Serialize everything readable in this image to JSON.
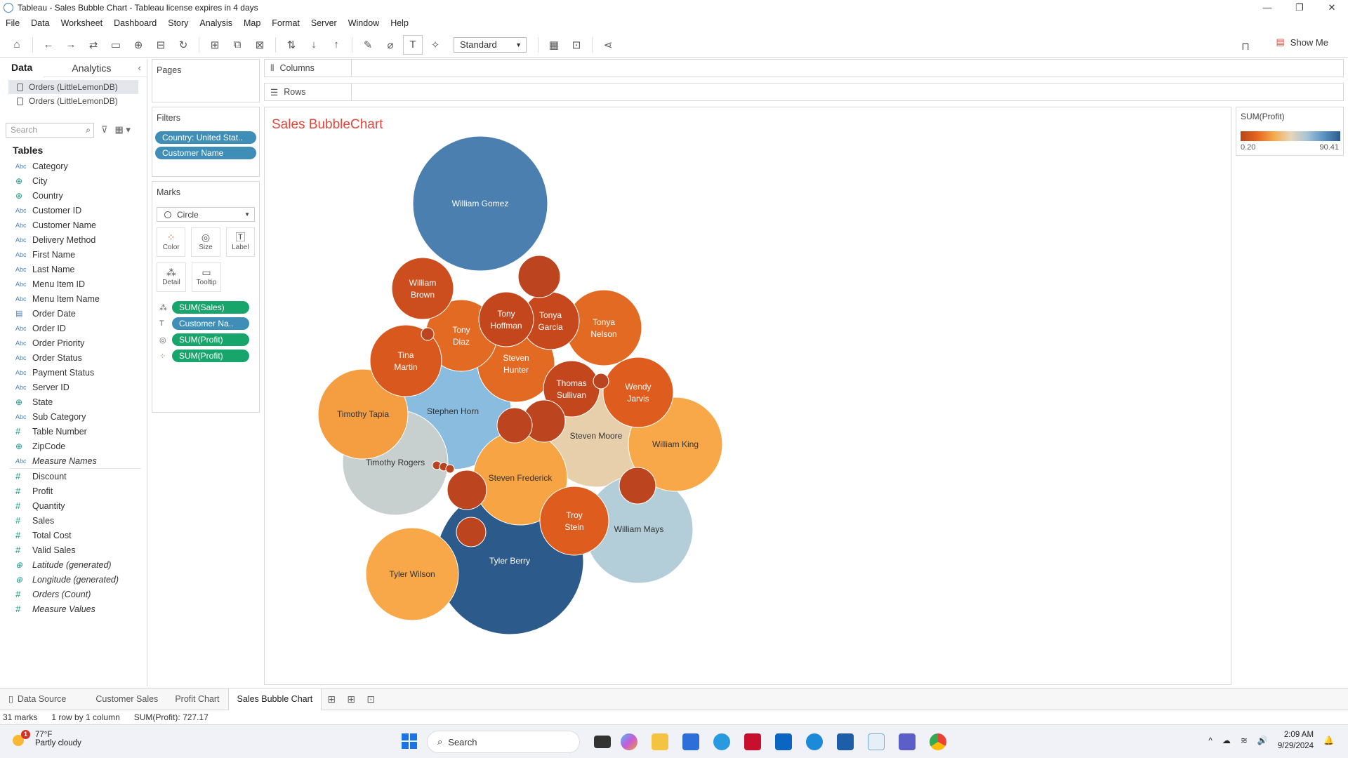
{
  "window": {
    "title": "Tableau - Sales Bubble Chart - Tableau license expires in 4 days"
  },
  "menu": [
    "File",
    "Data",
    "Worksheet",
    "Dashboard",
    "Story",
    "Analysis",
    "Map",
    "Format",
    "Server",
    "Window",
    "Help"
  ],
  "toolbar": {
    "fit_select": "Standard",
    "show_me": "Show Me"
  },
  "datapane": {
    "tab_data": "Data",
    "tab_analytics": "Analytics",
    "sources": [
      "Orders (LittleLemonDB)",
      "Orders (LittleLemonDB)"
    ],
    "search_placeholder": "Search",
    "tables_heading": "Tables",
    "dimensions": [
      {
        "icon": "Abc",
        "name": "Category"
      },
      {
        "icon": "geo",
        "name": "City"
      },
      {
        "icon": "geo",
        "name": "Country"
      },
      {
        "icon": "Abc",
        "name": "Customer ID"
      },
      {
        "icon": "Abc",
        "name": "Customer Name"
      },
      {
        "icon": "Abc",
        "name": "Delivery Method"
      },
      {
        "icon": "Abc",
        "name": "First Name"
      },
      {
        "icon": "Abc",
        "name": "Last Name"
      },
      {
        "icon": "Abc",
        "name": "Menu Item ID"
      },
      {
        "icon": "Abc",
        "name": "Menu Item Name"
      },
      {
        "icon": "date",
        "name": "Order Date"
      },
      {
        "icon": "Abc",
        "name": "Order ID"
      },
      {
        "icon": "Abc",
        "name": "Order Priority"
      },
      {
        "icon": "Abc",
        "name": "Order Status"
      },
      {
        "icon": "Abc",
        "name": "Payment Status"
      },
      {
        "icon": "Abc",
        "name": "Server ID"
      },
      {
        "icon": "geo",
        "name": "State"
      },
      {
        "icon": "Abc",
        "name": "Sub Category"
      },
      {
        "icon": "num",
        "name": "Table Number"
      },
      {
        "icon": "geo",
        "name": "ZipCode"
      },
      {
        "icon": "Abc",
        "name": "Measure Names",
        "italic": true
      }
    ],
    "measures": [
      {
        "icon": "num",
        "name": "Discount"
      },
      {
        "icon": "num",
        "name": "Profit"
      },
      {
        "icon": "num",
        "name": "Quantity"
      },
      {
        "icon": "num",
        "name": "Sales"
      },
      {
        "icon": "num",
        "name": "Total Cost"
      },
      {
        "icon": "num",
        "name": "Valid Sales"
      },
      {
        "icon": "geo",
        "name": "Latitude (generated)",
        "italic": true
      },
      {
        "icon": "geo",
        "name": "Longitude (generated)",
        "italic": true
      },
      {
        "icon": "num",
        "name": "Orders (Count)",
        "italic": true
      },
      {
        "icon": "num",
        "name": "Measure Values",
        "italic": true
      }
    ]
  },
  "cards": {
    "pages": "Pages",
    "filters": "Filters",
    "filter_pills": [
      "Country: United Stat..",
      "Customer Name"
    ],
    "marks": "Marks",
    "mark_type": "Circle",
    "mark_buttons": [
      "Color",
      "Size",
      "Label",
      "Detail",
      "Tooltip"
    ],
    "mark_pills": [
      "SUM(Sales)",
      "Customer Na..",
      "SUM(Profit)",
      "SUM(Profit)"
    ]
  },
  "shelves": {
    "columns": "Columns",
    "rows": "Rows"
  },
  "view": {
    "title": "Sales BubbleChart"
  },
  "legend": {
    "title": "SUM(Profit)",
    "min": "0.20",
    "max": "90.41"
  },
  "chart_data": {
    "type": "bubble",
    "title": "Sales BubbleChart",
    "size_measure": "SUM(Sales)",
    "color_measure": "SUM(Profit)",
    "color_range": [
      0.2,
      90.41
    ],
    "bubbles": [
      {
        "label": "William Gomez",
        "color": "#4a7fb0"
      },
      {
        "label": "Tyler Berry",
        "color": "#2b5a8b"
      },
      {
        "label": "Stephen Horn",
        "color": "#89bcdf"
      },
      {
        "label": "Steven Moore",
        "color": "#e8cfac"
      },
      {
        "label": "Timothy Rogers",
        "color": "#c8d0cf"
      },
      {
        "label": "William Mays",
        "color": "#b4ced9"
      },
      {
        "label": "Timothy Tapia",
        "color": "#f59d41"
      },
      {
        "label": "Steven Frederick",
        "color": "#f7a444"
      },
      {
        "label": "William King",
        "color": "#f8a848"
      },
      {
        "label": "Tyler Wilson",
        "color": "#f8a848"
      },
      {
        "label": "Tonya Nelson",
        "color": "#e36a22"
      },
      {
        "label": "Wendy Jarvis",
        "color": "#dd5c1e"
      },
      {
        "label": "Steven Hunter",
        "color": "#e36a22"
      },
      {
        "label": "Tony Diaz",
        "color": "#e36a22"
      },
      {
        "label": "Tina Martin",
        "color": "#d9581e"
      },
      {
        "label": "William Brown",
        "color": "#cc4d1d"
      },
      {
        "label": "Troy Stein",
        "color": "#dd5c1e"
      },
      {
        "label": "Tonya Garcia",
        "color": "#c7481d"
      },
      {
        "label": "Thomas Sullivan",
        "color": "#c4461d"
      },
      {
        "label": "Tony Hoffman",
        "color": "#c4461d"
      },
      {
        "label": "",
        "color": "#bc4520"
      },
      {
        "label": "",
        "color": "#bc4520"
      },
      {
        "label": "",
        "color": "#bc4520"
      },
      {
        "label": "",
        "color": "#bc4520"
      },
      {
        "label": "",
        "color": "#bc4520"
      },
      {
        "label": "",
        "color": "#bc4520"
      },
      {
        "label": "",
        "color": "#bc4520"
      },
      {
        "label": "",
        "color": "#b94520"
      },
      {
        "label": "",
        "color": "#b94520"
      },
      {
        "label": "",
        "color": "#b94520"
      },
      {
        "label": "",
        "color": "#b94520"
      }
    ]
  },
  "sheet_tabs": [
    "Data Source",
    "Customer Sales",
    "Profit Chart",
    "Sales Bubble Chart"
  ],
  "status": {
    "marks": "31 marks",
    "dims": "1 row by 1 column",
    "sum": "SUM(Profit): 727.17"
  },
  "taskbar": {
    "temp": "77°F",
    "weather": "Partly cloudy",
    "search": "Search",
    "time": "2:09 AM",
    "date": "9/29/2024"
  }
}
